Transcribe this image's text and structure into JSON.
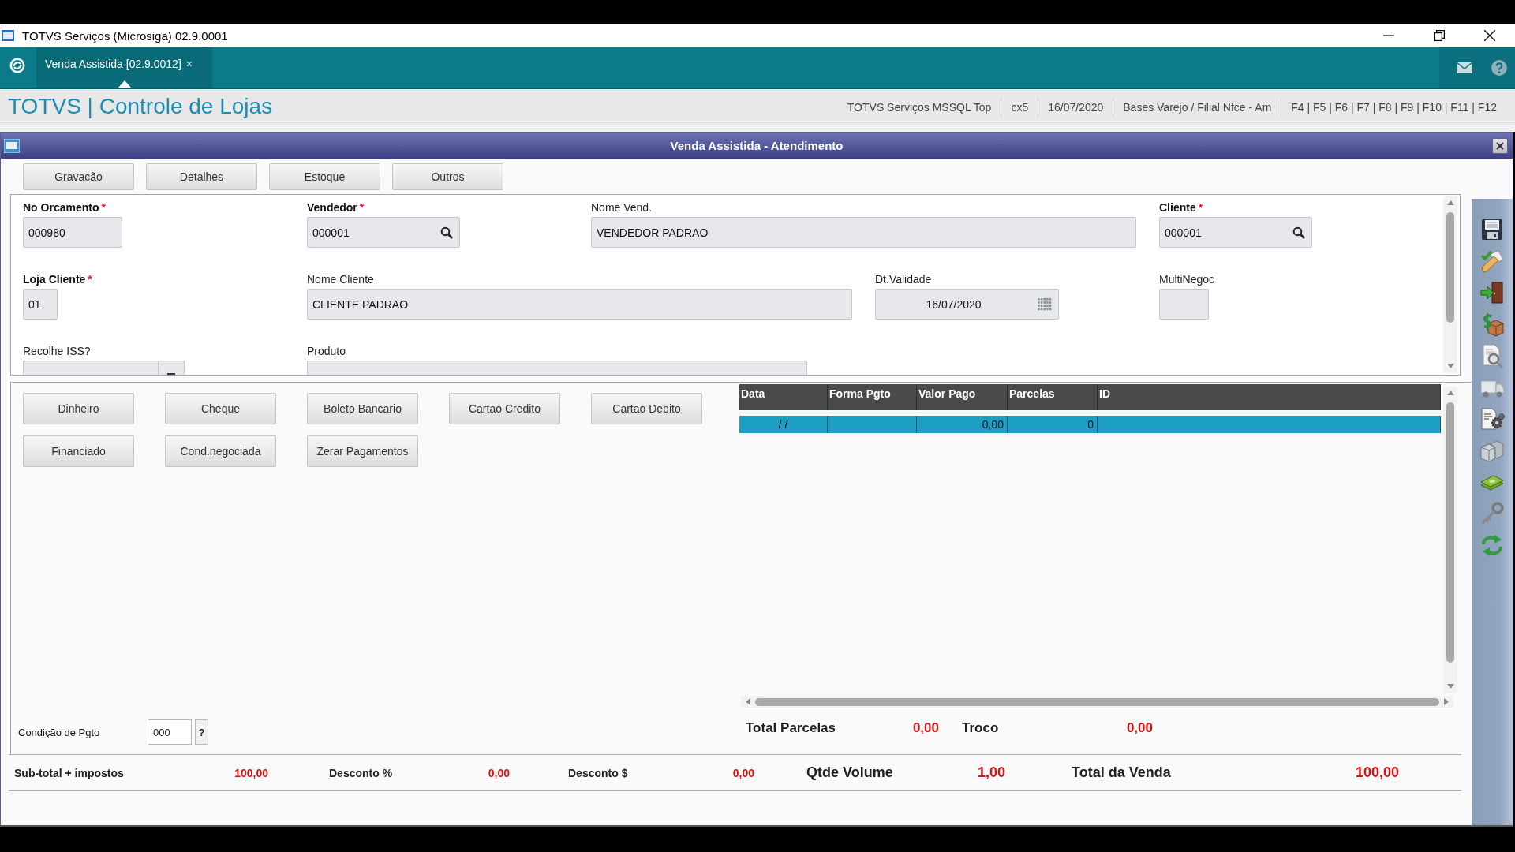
{
  "window": {
    "title": "TOTVS Serviços (Microsiga) 02.9.0001"
  },
  "tabs": [
    {
      "label": "Venda Assistida [02.9.0012]",
      "close": "×",
      "selected": true
    }
  ],
  "header": {
    "title": "TOTVS | Controle de Lojas",
    "info": [
      "TOTVS Serviços MSSQL Top",
      "cx5",
      "16/07/2020",
      "Bases Varejo / Filial Nfce - Am",
      "F4 | F5 | F6 | F7 | F8 | F9 | F10 | F11 | F12"
    ]
  },
  "dialog": {
    "title": "Venda Assistida - Atendimento"
  },
  "actions": [
    "Gravacão",
    "Detalhes",
    "Estoque",
    "Outros"
  ],
  "form": {
    "rows": [
      [
        {
          "label": "No Orcamento",
          "required_mark": "*",
          "kind": "text",
          "value": "000980"
        },
        {
          "label": "Vendedor",
          "required_mark": "*",
          "kind": "lookup",
          "value": "000001"
        },
        {
          "label": "Nome Vend.",
          "kind": "text",
          "value": "VENDEDOR PADRAO"
        },
        {
          "label": "Cliente",
          "required_mark": "*",
          "kind": "lookup",
          "value": "000001"
        }
      ],
      [
        {
          "label": "Loja Cliente",
          "required_mark": "*",
          "kind": "text",
          "value": "01"
        },
        {
          "label": "Nome Cliente",
          "kind": "text",
          "value": "CLIENTE PADRAO"
        },
        {
          "label": "Dt.Validade",
          "kind": "date",
          "value": "16/07/2020"
        },
        {
          "label": "MultiNegoc",
          "kind": "text"
        }
      ],
      [
        {
          "label": "Recolhe ISS?",
          "kind": "combo"
        },
        {
          "label": "Produto",
          "kind": "text"
        }
      ]
    ]
  },
  "payment_buttons": [
    "Dinheiro",
    "Cheque",
    "Boleto Bancario",
    "Cartao Credito",
    "Cartao Debito",
    "Financiado",
    "Cond.negociada",
    "Zerar Pagamentos"
  ],
  "payment_grid": {
    "columns": [
      "Data",
      "Forma Pgto",
      "Valor Pago",
      "Parcelas",
      "ID"
    ],
    "rows": [
      {
        "selected": true,
        "data": "/ /",
        "valor_pago": "0,00",
        "parcelas": "0"
      }
    ]
  },
  "payment_condition": {
    "label": "Condição de Pgto",
    "value": "000",
    "button": "?"
  },
  "payment_totals": [
    {
      "label": "Total Parcelas",
      "value": "0,00"
    },
    {
      "label": "Troco",
      "value": "0,00"
    }
  ],
  "summary": [
    {
      "label": "Sub-total + impostos",
      "value": "100,00"
    },
    {
      "label": "Desconto %",
      "value": "0,00"
    },
    {
      "label": "Desconto $",
      "value": "0,00"
    },
    {
      "label": "Qtde Volume",
      "value": "1,00"
    },
    {
      "label": "Total da Venda",
      "value": "100,00"
    }
  ],
  "toolbar": [
    {
      "kind": "save",
      "disabled": false
    },
    {
      "kind": "pencil",
      "disabled": false
    },
    {
      "kind": "door",
      "disabled": false
    },
    {
      "kind": "moneybox",
      "disabled": false
    },
    {
      "kind": "docsearch",
      "disabled": false
    },
    {
      "kind": "truck",
      "disabled": true
    },
    {
      "kind": "docgear",
      "disabled": false
    },
    {
      "kind": "boxes",
      "disabled": true
    },
    {
      "kind": "cash",
      "disabled": false
    },
    {
      "kind": "key",
      "disabled": false
    },
    {
      "kind": "refresh",
      "disabled": false
    }
  ]
}
